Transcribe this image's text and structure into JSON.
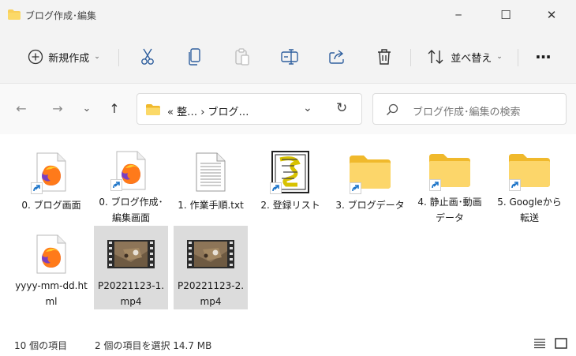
{
  "window": {
    "title": "ブログ作成･編集",
    "min_glyph": "─",
    "max_glyph": "☐",
    "close_glyph": "✕"
  },
  "toolbar": {
    "new_label": "新規作成",
    "new_chevron": "⌄",
    "sort_label": "並べ替え",
    "sort_chevron": "⌄",
    "more_glyph": "···"
  },
  "nav": {
    "back_glyph": "←",
    "forward_glyph": "→",
    "recent_glyph": "⌄",
    "up_glyph": "↑"
  },
  "address": {
    "path": "«  整…  ›  ブログ…",
    "dropdown_glyph": "⌄",
    "refresh_glyph": "↻"
  },
  "search": {
    "placeholder": "ブログ作成･編集の検索"
  },
  "files": [
    {
      "label": "0. ブログ画面",
      "icon": "firefox-html-icon",
      "selected": false
    },
    {
      "label": "0. ブログ作成･編集画面",
      "icon": "firefox-html-icon",
      "selected": false
    },
    {
      "label": "1. 作業手順.txt",
      "icon": "text-file-icon",
      "selected": false
    },
    {
      "label": "2. 登録リスト",
      "icon": "list-file-icon",
      "selected": false
    },
    {
      "label": "3. ブログデータ",
      "icon": "folder-shortcut-icon",
      "selected": false
    },
    {
      "label": "4. 静止画･動画データ",
      "icon": "folder-shortcut-icon",
      "selected": false
    },
    {
      "label": "5. Googleから転送",
      "icon": "folder-shortcut-icon",
      "selected": false
    },
    {
      "label": "yyyy-mm-dd.html",
      "icon": "firefox-html-icon",
      "selected": false
    },
    {
      "label": "P20221123-1.mp4",
      "icon": "video-file-icon",
      "selected": true
    },
    {
      "label": "P20221123-2.mp4",
      "icon": "video-file-icon",
      "selected": true
    }
  ],
  "status": {
    "item_count": "10 個の項目",
    "selection": "2 個の項目を選択  14.7 MB"
  },
  "colors": {
    "folder_yellow": "#f8cf5a",
    "selection_gray": "#dcdcdc",
    "accent_blue": "#1a73c8"
  }
}
